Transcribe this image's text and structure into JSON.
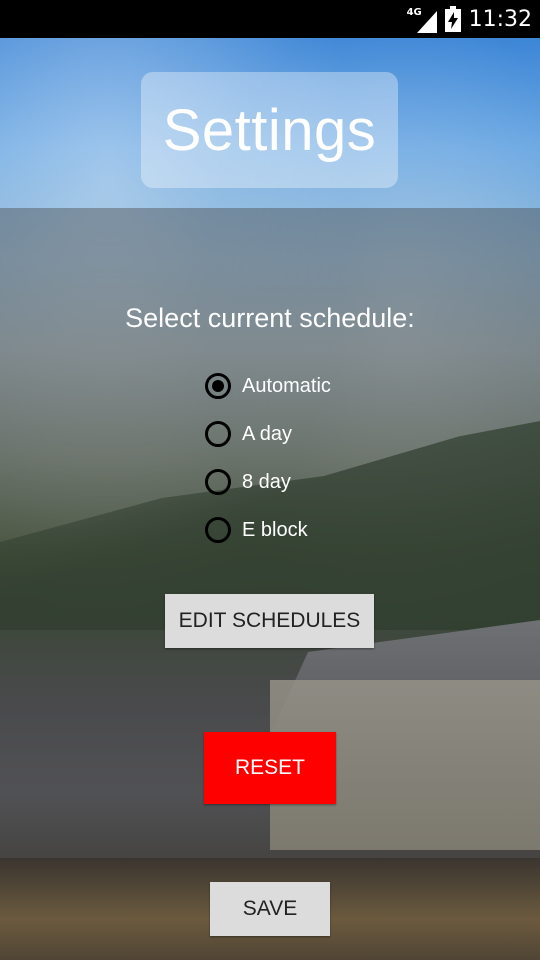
{
  "status_bar": {
    "network": "4G",
    "time": "11:32",
    "icons": [
      "signal-icon",
      "battery-charging-icon"
    ]
  },
  "page": {
    "title": "Settings",
    "prompt": "Select current schedule:"
  },
  "schedule_options": [
    {
      "label": "Automatic",
      "checked": true
    },
    {
      "label": "A day",
      "checked": false
    },
    {
      "label": "8 day",
      "checked": false
    },
    {
      "label": "E block",
      "checked": false
    }
  ],
  "buttons": {
    "edit_schedules": "EDIT SCHEDULES",
    "reset": "RESET",
    "save": "SAVE"
  },
  "colors": {
    "reset_button": "#ff0000",
    "button_gray": "#dcdcdc",
    "status_bar": "#000000"
  }
}
